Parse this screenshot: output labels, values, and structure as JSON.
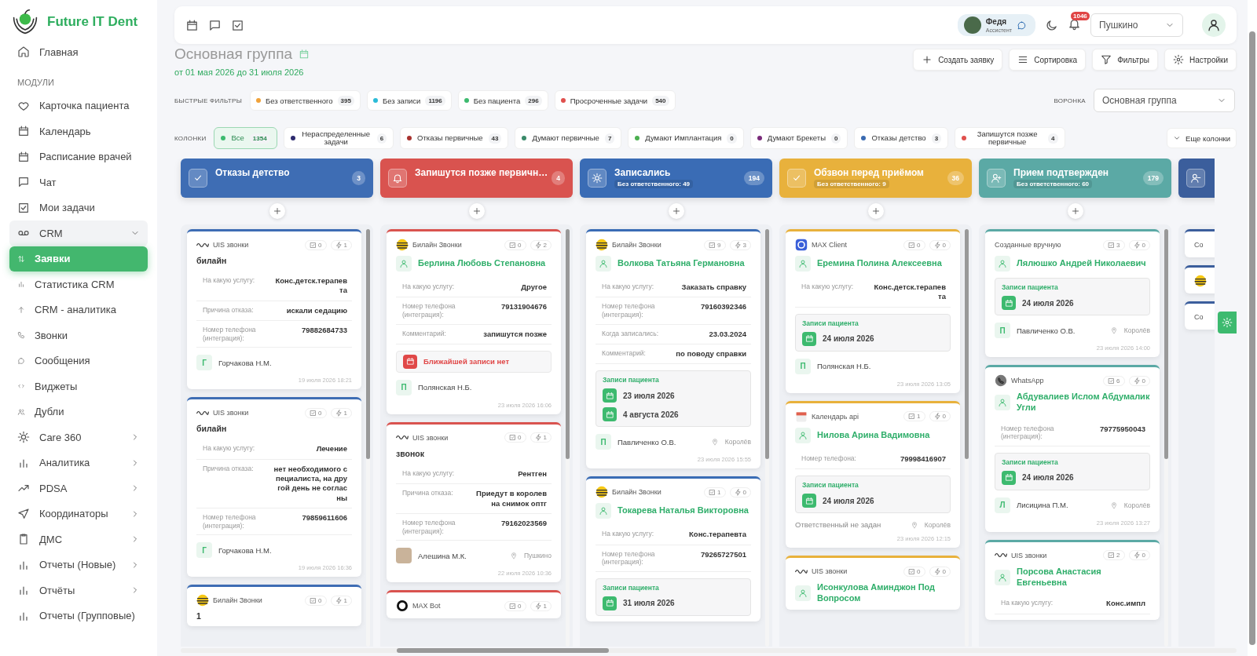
{
  "sidebar": {
    "logo": "Future IT Dent",
    "home": {
      "label": "Главная",
      "selected": false
    },
    "section": "МОДУЛИ",
    "items": [
      {
        "label": "Карточка пациента",
        "selected": false
      },
      {
        "label": "Календарь",
        "selected": false
      },
      {
        "label": "Расписание врачей",
        "selected": false
      },
      {
        "label": "Чат",
        "selected": false
      },
      {
        "label": "Мои задачи",
        "selected": false
      },
      {
        "label": "CRM",
        "selected": false,
        "expanded": true,
        "children": [
          {
            "label": "Заявки",
            "selected": true
          },
          {
            "label": "Статистика CRM",
            "selected": false
          },
          {
            "label": "CRM - аналитика",
            "selected": false
          },
          {
            "label": "Звонки",
            "selected": false
          },
          {
            "label": "Сообщения",
            "selected": false
          },
          {
            "label": "Виджеты",
            "selected": false
          },
          {
            "label": "Дубли",
            "selected": false
          }
        ]
      },
      {
        "label": "Care 360",
        "selected": false,
        "expanded": false
      },
      {
        "label": "Аналитика",
        "selected": false,
        "expanded": false
      },
      {
        "label": "PDSA",
        "selected": false,
        "expanded": false
      },
      {
        "label": "Координаторы",
        "selected": false,
        "expanded": false
      },
      {
        "label": "ДМС",
        "selected": false,
        "expanded": false
      },
      {
        "label": "Отчеты (Новые)",
        "selected": false,
        "expanded": false
      },
      {
        "label": "Отчёты",
        "selected": false,
        "expanded": false
      },
      {
        "label": "Отчеты (Групповые)",
        "selected": false,
        "expanded": false
      }
    ]
  },
  "toolbar": {
    "user": {
      "name": "Федя",
      "role": "Ассистент"
    },
    "notifications": "1046",
    "branch": "Пушкино"
  },
  "title": "Основная группа",
  "period": "от 01 мая 2026 до 31 июля 2026",
  "actions": [
    "Создать заявку",
    "Сортировка",
    "Фильтры",
    "Настройки"
  ],
  "quick_filters": {
    "label": "БЫСТРЫЕ ФИЛЬТРЫ",
    "items": [
      {
        "label": "Без ответственного",
        "count": "395",
        "color": "#f0a23a"
      },
      {
        "label": "Без записи",
        "count": "1196",
        "color": "#2bbbd8"
      },
      {
        "label": "Без пациента",
        "count": "296",
        "color": "#3dba6f"
      },
      {
        "label": "Просроченные задачи",
        "count": "540",
        "color": "#e0504d"
      }
    ]
  },
  "funnel": {
    "label": "ВОРОНКА",
    "value": "Основная группа"
  },
  "column_filters": {
    "label": "КОЛОНКИ",
    "more": "Еще колонки",
    "items": [
      {
        "label": "Все",
        "count": "1354",
        "color": "#3dba6f",
        "selected": true
      },
      {
        "label": "Нераспределенные задачи",
        "count": "6",
        "color": "#2d2a6e",
        "selected": false
      },
      {
        "label": "Отказы первичные",
        "count": "43",
        "color": "#a8322e",
        "selected": false
      },
      {
        "label": "Думают первичные",
        "count": "7",
        "color": "#3a8a6a",
        "selected": false
      },
      {
        "label": "Думают Имплантация",
        "count": "0",
        "color": "#4caf50",
        "selected": false
      },
      {
        "label": "Думают Брекеты",
        "count": "0",
        "color": "#7a2a7a",
        "selected": false
      },
      {
        "label": "Отказы детство",
        "count": "3",
        "color": "#3a6ab0",
        "selected": false
      },
      {
        "label": "Запишутся позже первичные",
        "count": "4",
        "color": "#e0504d",
        "selected": false
      }
    ]
  },
  "columns": [
    {
      "title": "Отказы детство",
      "count": "3",
      "color": "#3e6db4",
      "cards": [
        {
          "source": {
            "kind": "uis",
            "name": "UIS звонки"
          },
          "tasks": "0",
          "events": "1",
          "title": {
            "kind": "plain",
            "text": "билайн"
          },
          "fields": [
            {
              "label": "На какую услугу:",
              "value": "Конс.детск.терапевта"
            },
            {
              "label": "Причина отказа:",
              "value": "искали седацию"
            },
            {
              "label": "Номер телефона (интеграция):",
              "value": "79882684733"
            }
          ],
          "responsible": {
            "kind": "initial",
            "initial": "Г",
            "name": "Горчакова Н.М."
          },
          "time": "19 июля 2026 18:21"
        },
        {
          "source": {
            "kind": "uis",
            "name": "UIS звонки"
          },
          "tasks": "0",
          "events": "1",
          "title": {
            "kind": "plain",
            "text": "билайн"
          },
          "fields": [
            {
              "label": "На какую услугу:",
              "value": "Лечение"
            },
            {
              "label": "Причина отказа:",
              "value": "нет необходимого специалиста, на другой день не согласны"
            },
            {
              "label": "Номер телефона (интеграция):",
              "value": "79859611606"
            }
          ],
          "responsible": {
            "kind": "initial",
            "initial": "Г",
            "name": "Горчакова Н.М."
          },
          "time": "19 июля 2026 16:36"
        },
        {
          "source": {
            "kind": "beeline",
            "name": "Билайн Звонки"
          },
          "tasks": "0",
          "events": "1",
          "title": {
            "kind": "plain",
            "text": "1"
          }
        }
      ]
    },
    {
      "title": "Запишутся позже первичн…",
      "count": "4",
      "color": "#d9534f",
      "cards": [
        {
          "source": {
            "kind": "beeline",
            "name": "Билайн Звонки"
          },
          "tasks": "0",
          "events": "2",
          "title": {
            "kind": "patient",
            "text": "Берлина Любовь Степановна"
          },
          "fields": [
            {
              "label": "На какую услугу:",
              "value": "Другое"
            },
            {
              "label": "Номер телефона (интеграция):",
              "value": "79131904676"
            },
            {
              "label": "Комментарий:",
              "value": "запишутся позже"
            }
          ],
          "alert": "Ближайшей записи нет",
          "responsible": {
            "kind": "initial",
            "initial": "П",
            "name": "Полянская Н.Б."
          },
          "time": "23 июля 2026 16:06"
        },
        {
          "source": {
            "kind": "uis",
            "name": "UIS звонки"
          },
          "tasks": "0",
          "events": "1",
          "title": {
            "kind": "plain",
            "text": "звонок"
          },
          "fields": [
            {
              "label": "На какую услугу:",
              "value": "Рентген"
            },
            {
              "label": "Причина отказа:",
              "value": "Приедут в королев на снимок оптг"
            },
            {
              "label": "Номер телефона (интеграция):",
              "value": "79162023569"
            }
          ],
          "responsible": {
            "kind": "photo",
            "name": "Алешина М.К.",
            "location": "Пушкино"
          },
          "time": "22 июля 2026 10:36"
        },
        {
          "source": {
            "kind": "bot",
            "name": "MAX Bot"
          },
          "tasks": "0",
          "events": "1"
        }
      ]
    },
    {
      "title": "Записались",
      "subtitle": "Без ответственного: 49",
      "count": "194",
      "color": "#3a6cb5",
      "cards": [
        {
          "source": {
            "kind": "beeline",
            "name": "Билайн Звонки"
          },
          "tasks": "9",
          "events": "3",
          "title": {
            "kind": "patient",
            "text": "Волкова Татьяна Германовна"
          },
          "fields": [
            {
              "label": "На какую услугу:",
              "value": "Заказать справку"
            },
            {
              "label": "Номер телефона (интеграция):",
              "value": "79160392346"
            },
            {
              "label": "Когда записались:",
              "value": "23.03.2024"
            },
            {
              "label": "Комментарий:",
              "value": "по поводу справки"
            }
          ],
          "appointments": {
            "title": "Записи пациента",
            "dates": [
              "23 июля 2026",
              "4 августа 2026"
            ]
          },
          "responsible": {
            "kind": "initial",
            "initial": "П",
            "name": "Павличенко О.В.",
            "location": "Королёв"
          },
          "time": "23 июля 2026 15:55"
        },
        {
          "source": {
            "kind": "beeline",
            "name": "Билайн Звонки"
          },
          "tasks": "1",
          "events": "0",
          "title": {
            "kind": "patient",
            "text": "Токарева Наталья Викторовна"
          },
          "fields": [
            {
              "label": "На какую услугу:",
              "value": "Конс.терапевта"
            },
            {
              "label": "Номер телефона (интеграция):",
              "value": "79265727501"
            }
          ],
          "appointments": {
            "title": "Записи пациента",
            "dates": [
              "31 июля 2026"
            ]
          }
        }
      ]
    },
    {
      "title": "Обзвон перед приёмом",
      "subtitle": "Без ответственного: 9",
      "count": "36",
      "color": "#e8b13c",
      "cards": [
        {
          "source": {
            "kind": "max",
            "name": "MAX Client"
          },
          "tasks": "0",
          "events": "0",
          "title": {
            "kind": "patient",
            "text": "Еремина Полина Алексеевна"
          },
          "fields": [
            {
              "label": "На какую услугу:",
              "value": "Конс.детск.терапевта"
            }
          ],
          "appointments": {
            "title": "Записи пациента",
            "dates": [
              "24 июля 2026"
            ]
          },
          "responsible": {
            "kind": "initial",
            "initial": "П",
            "name": "Полянская Н.Б."
          },
          "time": "23 июля 2026 13:05"
        },
        {
          "source": {
            "kind": "calendar",
            "name": "Календарь api"
          },
          "tasks": "1",
          "events": "0",
          "title": {
            "kind": "patient",
            "text": "Нилова Арина Вадимовна"
          },
          "fields": [
            {
              "label": "Номер телефона:",
              "value": "79998416907"
            }
          ],
          "appointments": {
            "title": "Записи пациента",
            "dates": [
              "24 июля 2026"
            ]
          },
          "responsible": {
            "kind": "none",
            "name": "Ответственный не задан",
            "location": "Королёв"
          },
          "time": "23 июля 2026 12:15"
        },
        {
          "source": {
            "kind": "uis",
            "name": "UIS звонки"
          },
          "tasks": "0",
          "events": "0",
          "title": {
            "kind": "patient",
            "text": "Исонкулова Аминджон Под Вопросом"
          }
        }
      ]
    },
    {
      "title": "Прием подтвержден",
      "subtitle": "Без ответственного: 60",
      "count": "179",
      "color": "#5ba9a5",
      "cards": [
        {
          "source": {
            "kind": "manual",
            "name": "Созданные вручную"
          },
          "tasks": "3",
          "events": "0",
          "title": {
            "kind": "patient",
            "text": "Лялюшко Андрей Николаевич"
          },
          "appointments": {
            "title": "Записи пациента",
            "dates": [
              "24 июля 2026"
            ]
          },
          "responsible": {
            "kind": "initial",
            "initial": "П",
            "name": "Павличенко О.В.",
            "location": "Королёв"
          },
          "time": "23 июля 2026 14:00"
        },
        {
          "source": {
            "kind": "whatsapp",
            "name": "WhatsApp"
          },
          "tasks": "6",
          "events": "0",
          "title": {
            "kind": "patient",
            "text": "Абдувалиев Ислом Абдумалик Угли"
          },
          "fields": [
            {
              "label": "Номер телефона (интеграция):",
              "value": "79775950043"
            }
          ],
          "appointments": {
            "title": "Записи пациента",
            "dates": [
              "24 июля 2026"
            ]
          },
          "responsible": {
            "kind": "initial",
            "initial": "Л",
            "name": "Лисицина П.М.",
            "location": "Королёв"
          },
          "time": "23 июля 2026 13:27"
        },
        {
          "source": {
            "kind": "uis",
            "name": "UIS звонки"
          },
          "tasks": "2",
          "events": "0",
          "title": {
            "kind": "patient",
            "text": "Порсова Анастасия Евгеньевна"
          },
          "fields": [
            {
              "label": "На какую услугу:",
              "value": "Конс.импл"
            }
          ]
        }
      ]
    },
    {
      "color": "#3b5e9c",
      "cards": [
        {
          "source": {
            "kind": "manual",
            "name": "Со"
          }
        },
        {
          "source": {
            "kind": "beeline"
          }
        },
        {
          "source": {
            "kind": "manual",
            "name": "Со"
          }
        }
      ]
    }
  ]
}
